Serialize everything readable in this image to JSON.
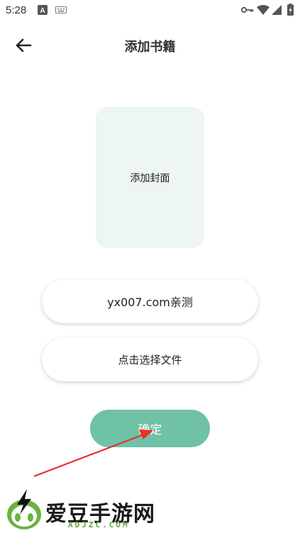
{
  "status_bar": {
    "time": "5:28",
    "icons": [
      "font-notification-icon",
      "keyboard-icon",
      "key-icon",
      "wifi-icon",
      "signal-icon",
      "battery-icon"
    ]
  },
  "header": {
    "back_icon": "arrow-left-icon",
    "title": "添加书籍"
  },
  "cover": {
    "label": "添加封面"
  },
  "form": {
    "name_value": "yx007.com亲测",
    "file_button_label": "点击选择文件",
    "confirm_label": "确定"
  },
  "watermark": {
    "brand": "爱豆手游网",
    "domain": "ADJZC.COM"
  },
  "colors": {
    "accent": "#6fc2a6",
    "cover_bg": "#edf6f2",
    "annotation_arrow": "#e8302a"
  }
}
